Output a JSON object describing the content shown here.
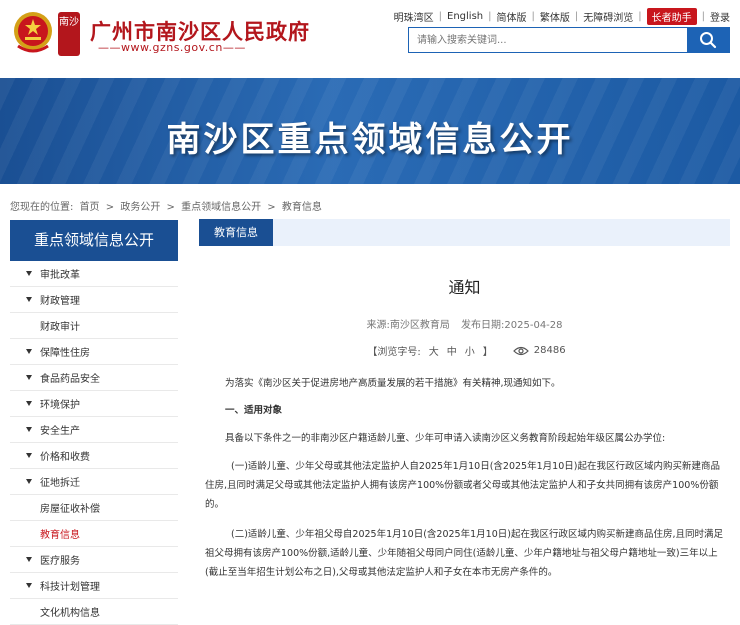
{
  "header": {
    "site_title": "广州市南沙区人民政府",
    "site_url": "——www.gzns.gov.cn——",
    "seal_text": "南沙",
    "links": [
      "明珠湾区",
      "English",
      "简体版",
      "繁体版",
      "无障碍浏览",
      "长者助手",
      "登录"
    ],
    "search_placeholder": "请输入搜索关键词..."
  },
  "banner": {
    "title": "南沙区重点领域信息公开"
  },
  "breadcrumb": [
    "您现在的位置:",
    "首页",
    ">",
    "政务公开",
    ">",
    "重点领域信息公开",
    ">",
    "教育信息"
  ],
  "sidebar": {
    "heading": "重点领域信息公开",
    "items": [
      {
        "label": "审批改革",
        "type": "group"
      },
      {
        "label": "财政管理",
        "type": "group"
      },
      {
        "label": "财政审计",
        "type": "sub"
      },
      {
        "label": "保障性住房",
        "type": "group"
      },
      {
        "label": "食品药品安全",
        "type": "group"
      },
      {
        "label": "环境保护",
        "type": "group"
      },
      {
        "label": "安全生产",
        "type": "group"
      },
      {
        "label": "价格和收费",
        "type": "group"
      },
      {
        "label": "征地拆迁",
        "type": "group"
      },
      {
        "label": "房屋征收补偿",
        "type": "sub"
      },
      {
        "label": "教育信息",
        "type": "sub-active"
      },
      {
        "label": "医疗服务",
        "type": "group"
      },
      {
        "label": "科技计划管理",
        "type": "group"
      },
      {
        "label": "文化机构信息",
        "type": "sub"
      }
    ]
  },
  "content": {
    "tab": "教育信息",
    "title": "通知",
    "source": "来源:南沙区教育局",
    "date": "发布日期:2025-04-28",
    "font_size_label": "【浏览字号:",
    "font_sizes": [
      "大",
      "中",
      "小"
    ],
    "font_size_end": "】",
    "views": "28486",
    "paragraphs": [
      "为落实《南沙区关于促进房地产高质量发展的若干措施》有关精神,现通知如下。",
      "一、适用对象",
      "具备以下条件之一的非南沙区户籍适龄儿童、少年可申请入读南沙区义务教育阶段起始年级区属公办学位:",
      "(一)适龄儿童、少年父母或其他法定监护人自2025年1月10日(含2025年1月10日)起在我区行政区域内购买新建商品住房,且同时满足父母或其他法定监护人拥有该房产100%份额或者父母或其他法定监护人和子女共同拥有该房产100%份额的。",
      "(二)适龄儿童、少年祖父母自2025年1月10日(含2025年1月10日)起在我区行政区域内购买新建商品住房,且同时满足祖父母拥有该房产100%份额,适龄儿童、少年随祖父母同户同住(适龄儿童、少年户籍地址与祖父母户籍地址一致)三年以上(截止至当年招生计划公布之日),父母或其他法定监护人和子女在本市无房产条件的。"
    ]
  },
  "colors": {
    "brand_red": "#b3161c",
    "brand_blue": "#1a4f93",
    "active_red": "#c8161d"
  }
}
